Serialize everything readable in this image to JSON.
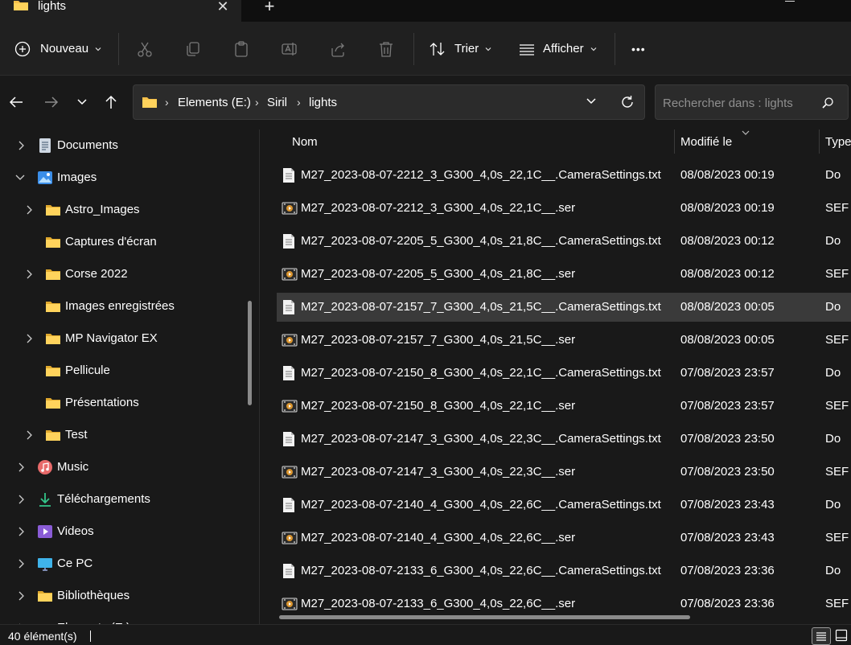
{
  "tab": {
    "title": "lights",
    "close": "✕",
    "new_tab": "+"
  },
  "toolbar": {
    "new_label": "Nouveau",
    "sort_label": "Trier",
    "view_label": "Afficher",
    "more": "•••"
  },
  "address": {
    "crumbs": [
      "Elements (E:)",
      "Siril",
      "lights"
    ],
    "separator": "›"
  },
  "search": {
    "placeholder": "Rechercher dans : lights"
  },
  "sidebar": {
    "items": [
      {
        "label": "Documents",
        "icon": "documents-icon",
        "expandable": true
      },
      {
        "label": "Images",
        "icon": "images-icon",
        "expandable": true,
        "expanded": true
      },
      {
        "label": "Astro_Images",
        "icon": "folder-icon",
        "expandable": true
      },
      {
        "label": "Captures d'écran",
        "icon": "folder-icon",
        "expandable": false
      },
      {
        "label": "Corse 2022",
        "icon": "folder-icon",
        "expandable": true
      },
      {
        "label": "Images enregistrées",
        "icon": "folder-icon",
        "expandable": false
      },
      {
        "label": "MP Navigator EX",
        "icon": "folder-icon",
        "expandable": true
      },
      {
        "label": "Pellicule",
        "icon": "folder-icon",
        "expandable": false
      },
      {
        "label": "Présentations",
        "icon": "folder-icon",
        "expandable": false
      },
      {
        "label": "Test",
        "icon": "folder-icon",
        "expandable": true
      },
      {
        "label": "Music",
        "icon": "music-icon",
        "expandable": true
      },
      {
        "label": "Téléchargements",
        "icon": "download-icon",
        "expandable": true
      },
      {
        "label": "Videos",
        "icon": "videos-icon",
        "expandable": true
      },
      {
        "label": "Ce PC",
        "icon": "pc-icon",
        "expandable": true
      },
      {
        "label": "Bibliothèques",
        "icon": "library-icon",
        "expandable": true
      },
      {
        "label": "Elements (E:)",
        "icon": "drive-icon",
        "expandable": true
      }
    ]
  },
  "columns": {
    "name": "Nom",
    "modified": "Modifié le",
    "type": "Type"
  },
  "files": [
    {
      "name": "M27_2023-08-07-2212_3_G300_4,0s_22,1C__.CameraSettings.txt",
      "modified": "08/08/2023 00:19",
      "type": "Do",
      "kind": "txt"
    },
    {
      "name": "M27_2023-08-07-2212_3_G300_4,0s_22,1C__.ser",
      "modified": "08/08/2023 00:19",
      "type": "SEF",
      "kind": "ser"
    },
    {
      "name": "M27_2023-08-07-2205_5_G300_4,0s_21,8C__.CameraSettings.txt",
      "modified": "08/08/2023 00:12",
      "type": "Do",
      "kind": "txt"
    },
    {
      "name": "M27_2023-08-07-2205_5_G300_4,0s_21,8C__.ser",
      "modified": "08/08/2023 00:12",
      "type": "SEF",
      "kind": "ser"
    },
    {
      "name": "M27_2023-08-07-2157_7_G300_4,0s_21,5C__.CameraSettings.txt",
      "modified": "08/08/2023 00:05",
      "type": "Do",
      "kind": "txt",
      "selected": true
    },
    {
      "name": "M27_2023-08-07-2157_7_G300_4,0s_21,5C__.ser",
      "modified": "08/08/2023 00:05",
      "type": "SEF",
      "kind": "ser"
    },
    {
      "name": "M27_2023-08-07-2150_8_G300_4,0s_22,1C__.CameraSettings.txt",
      "modified": "07/08/2023 23:57",
      "type": "Do",
      "kind": "txt"
    },
    {
      "name": "M27_2023-08-07-2150_8_G300_4,0s_22,1C__.ser",
      "modified": "07/08/2023 23:57",
      "type": "SEF",
      "kind": "ser"
    },
    {
      "name": "M27_2023-08-07-2147_3_G300_4,0s_22,3C__.CameraSettings.txt",
      "modified": "07/08/2023 23:50",
      "type": "Do",
      "kind": "txt"
    },
    {
      "name": "M27_2023-08-07-2147_3_G300_4,0s_22,3C__.ser",
      "modified": "07/08/2023 23:50",
      "type": "SEF",
      "kind": "ser"
    },
    {
      "name": "M27_2023-08-07-2140_4_G300_4,0s_22,6C__.CameraSettings.txt",
      "modified": "07/08/2023 23:43",
      "type": "Do",
      "kind": "txt"
    },
    {
      "name": "M27_2023-08-07-2140_4_G300_4,0s_22,6C__.ser",
      "modified": "07/08/2023 23:43",
      "type": "SEF",
      "kind": "ser"
    },
    {
      "name": "M27_2023-08-07-2133_6_G300_4,0s_22,6C__.CameraSettings.txt",
      "modified": "07/08/2023 23:36",
      "type": "Do",
      "kind": "txt"
    },
    {
      "name": "M27_2023-08-07-2133_6_G300_4,0s_22,6C__.ser",
      "modified": "07/08/2023 23:36",
      "type": "SEF",
      "kind": "ser"
    }
  ],
  "status": {
    "count": "40 élément(s)"
  },
  "colors": {
    "background": "#191919",
    "toolbar": "#202020",
    "selected_row": "#3a3a3a",
    "folder": "#f5c04a"
  }
}
